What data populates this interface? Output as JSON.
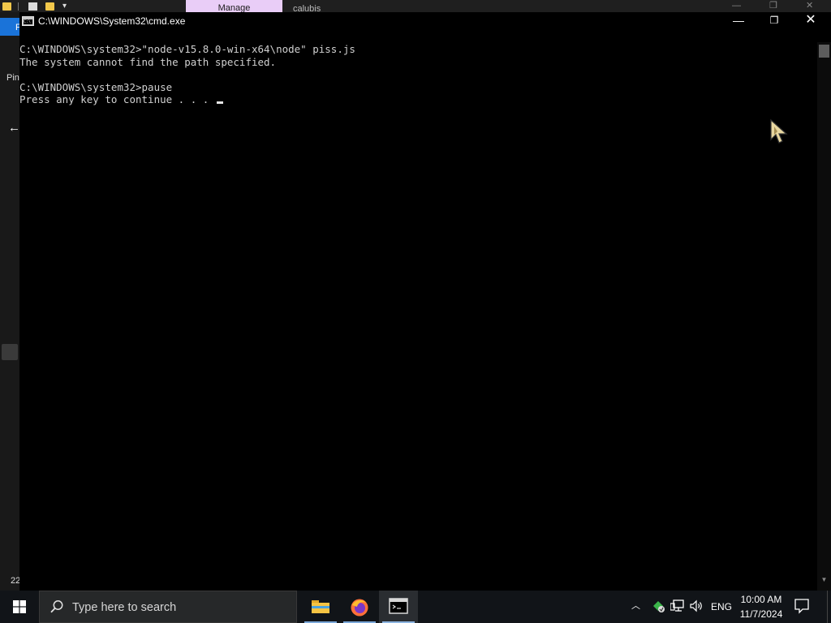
{
  "background_window": {
    "manage_tab": "Manage",
    "title_partial": "calubis",
    "file_tab_partial": "F",
    "pin_label_partial": "Pin",
    "status_partial": "22"
  },
  "cmd_window": {
    "title": "C:\\WINDOWS\\System32\\cmd.exe",
    "lines": [
      "C:\\WINDOWS\\system32>\"node-v15.8.0-win-x64\\node\" piss.js",
      "The system cannot find the path specified.",
      "",
      "C:\\WINDOWS\\system32>pause",
      "Press any key to continue . . . "
    ]
  },
  "taskbar": {
    "search_placeholder": "Type here to search",
    "apps": [
      "file-explorer",
      "firefox",
      "command-prompt"
    ],
    "language": "ENG",
    "time": "10:00 AM",
    "date": "11/7/2024"
  },
  "colors": {
    "console_background": "#000000",
    "console_text": "#d0d0d0",
    "manage_tab": "#e9cdf7",
    "taskbar": "#111418",
    "accent": "#1a73d9"
  },
  "icons": {
    "start": "windows-logo-icon",
    "search": "search-icon",
    "tray": [
      "chevron-up-icon",
      "sync-icon",
      "network-icon",
      "volume-icon",
      "notification-icon"
    ]
  }
}
